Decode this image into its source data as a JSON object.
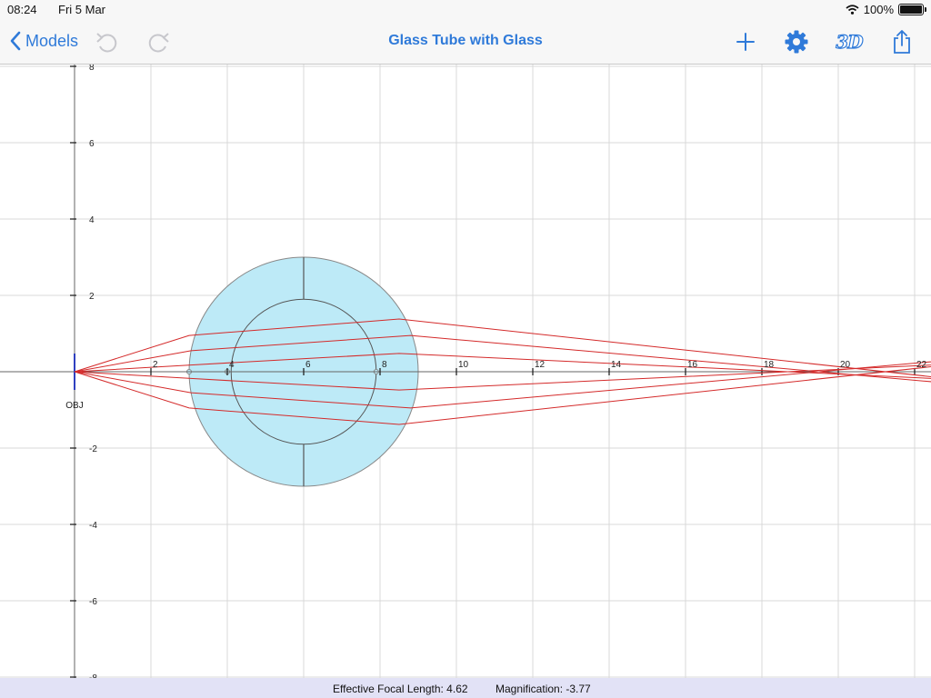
{
  "status_bar": {
    "time": "08:24",
    "date": "Fri 5 Mar",
    "battery": "100%"
  },
  "nav": {
    "back_label": "Models",
    "title": "Glass Tube with Glass",
    "three_d_label": "3D"
  },
  "icons": {
    "back": "chevron-left-icon",
    "undo": "undo-icon",
    "redo": "redo-icon",
    "add": "plus-icon",
    "settings": "gear-icon",
    "view_3d": "3d-icon",
    "share": "share-icon"
  },
  "colors": {
    "accent": "#2f7ad9",
    "ray": "#d42a2a",
    "glass": "#bdeaf7",
    "disabled": "#c7c7cc",
    "footer_bg": "#e2e2f6"
  },
  "plot": {
    "object_label": "OBJ",
    "x_ticks": [
      "2",
      "4",
      "6",
      "8",
      "10",
      "12",
      "14",
      "16",
      "18",
      "20",
      "22"
    ],
    "y_ticks": [
      "8",
      "6",
      "4",
      "2",
      "-2",
      "-4",
      "-6",
      "-8"
    ]
  },
  "footer": {
    "efl": "Effective Focal Length: 4.62",
    "magnification": "Magnification: -3.77"
  }
}
